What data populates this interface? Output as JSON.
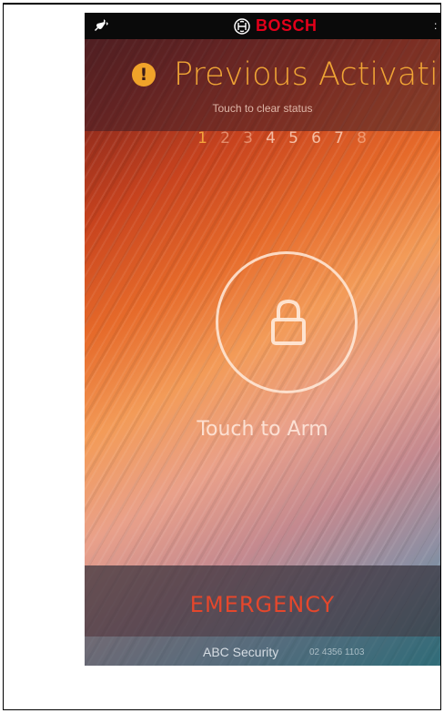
{
  "statusbar": {
    "brand": "BOSCH",
    "left_icon": "plug-icon",
    "logo_icon": "bosch-logo-icon",
    "right_glyph": ":"
  },
  "alert": {
    "icon": "exclamation-icon",
    "title": "Previous Activation",
    "subtitle": "Touch to clear status"
  },
  "zones": [
    {
      "label": "1",
      "state": "active"
    },
    {
      "label": "2",
      "state": "dim"
    },
    {
      "label": "3",
      "state": "dim"
    },
    {
      "label": "4",
      "state": "normal"
    },
    {
      "label": "5",
      "state": "normal"
    },
    {
      "label": "6",
      "state": "normal"
    },
    {
      "label": "7",
      "state": "normal"
    },
    {
      "label": "8",
      "state": "dim"
    }
  ],
  "arm": {
    "icon": "lock-icon",
    "label": "Touch to Arm"
  },
  "emergency": {
    "label": "EMERGENCY"
  },
  "footer": {
    "company": "ABC Security",
    "phone": "02 4356 1103"
  },
  "colors": {
    "alert_accent": "#f0a535",
    "emergency_red": "#e5472c",
    "brand_red": "#e2001a"
  }
}
